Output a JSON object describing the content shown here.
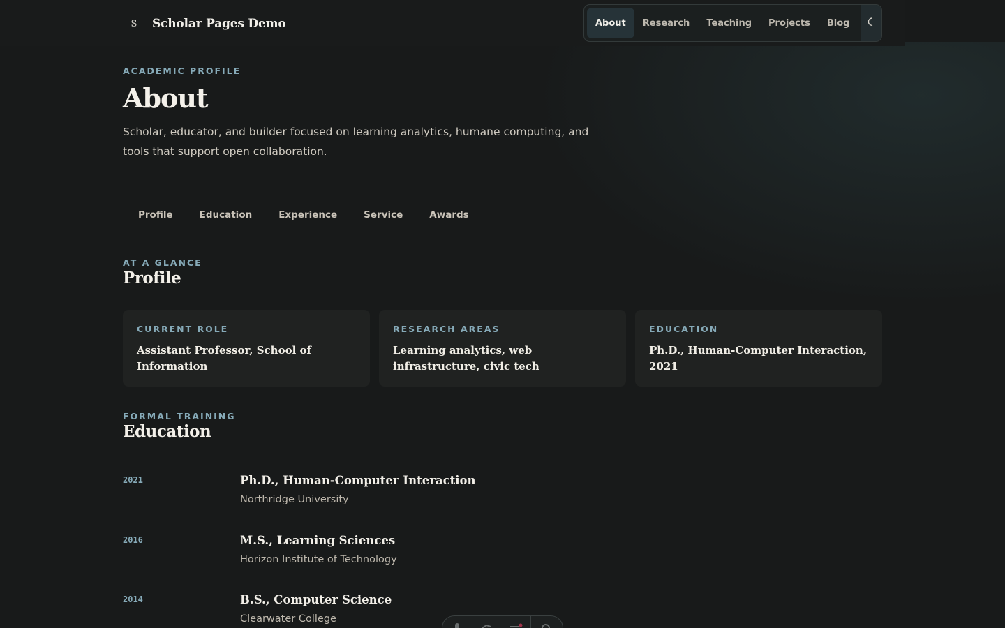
{
  "site": {
    "brand_mark": "S",
    "title": "Scholar Pages Demo"
  },
  "nav": {
    "items": [
      {
        "label": "About",
        "active": true
      },
      {
        "label": "Research",
        "active": false
      },
      {
        "label": "Teaching",
        "active": false
      },
      {
        "label": "Projects",
        "active": false
      },
      {
        "label": "Blog",
        "active": false
      }
    ],
    "theme_toggle_icon": "moon-icon"
  },
  "hero": {
    "eyebrow": "ACADEMIC PROFILE",
    "title": "About",
    "intro": "Scholar, educator, and builder focused on learning analytics, humane computing, and tools that support open collaboration."
  },
  "subnav": {
    "items": [
      "Profile",
      "Education",
      "Experience",
      "Service",
      "Awards"
    ]
  },
  "profile": {
    "eyebrow": "AT A GLANCE",
    "title": "Profile",
    "cards": [
      {
        "label": "CURRENT ROLE",
        "value": "Assistant Professor, School of Information"
      },
      {
        "label": "RESEARCH AREAS",
        "value": "Learning analytics, web infrastructure, civic tech"
      },
      {
        "label": "EDUCATION",
        "value": "Ph.D., Human-Computer Interaction, 2021"
      }
    ]
  },
  "education": {
    "eyebrow": "FORMAL TRAINING",
    "title": "Education",
    "entries": [
      {
        "year": "2021",
        "degree": "Ph.D., Human-Computer Interaction",
        "school": "Northridge University"
      },
      {
        "year": "2016",
        "degree": "M.S., Learning Sciences",
        "school": "Horizon Institute of Technology"
      },
      {
        "year": "2014",
        "degree": "B.S., Computer Science",
        "school": "Clearwater College"
      }
    ]
  },
  "floating_toolbar": {
    "icons": [
      "cursor-icon",
      "hand-icon",
      "menu-icon",
      "settings-icon"
    ]
  },
  "colors": {
    "background": "#181a1a",
    "accent": "#86aab8",
    "card": "#202221",
    "nav_active": "#263338"
  }
}
